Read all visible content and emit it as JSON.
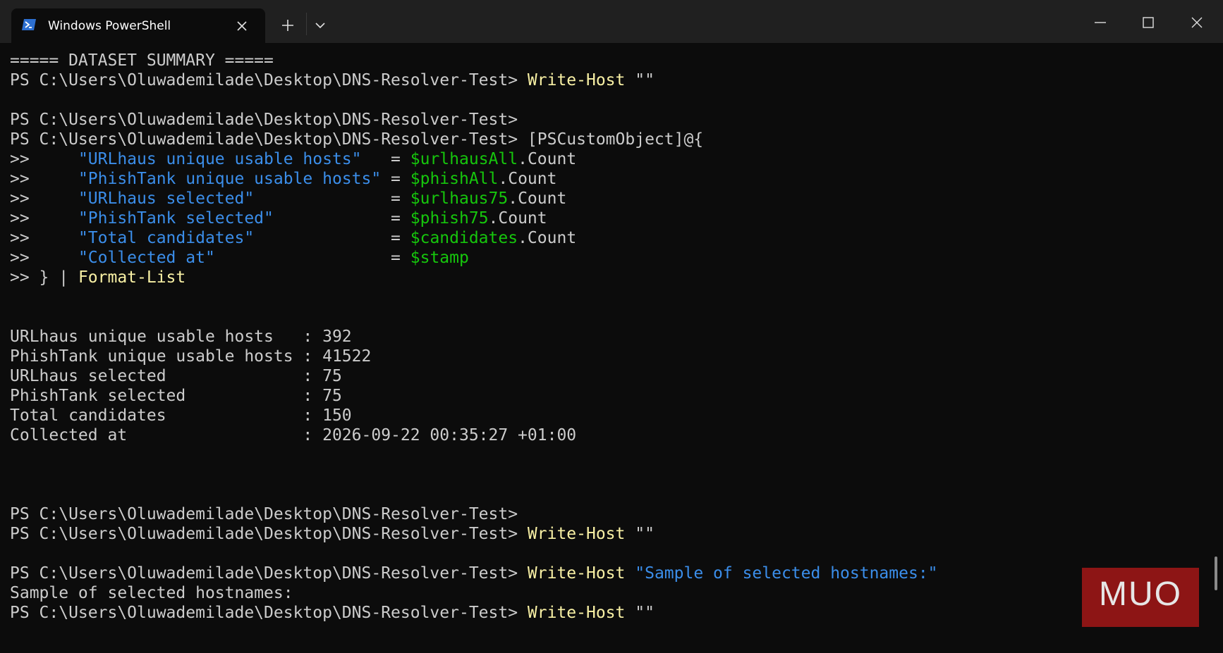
{
  "window": {
    "tab_title": "Windows PowerShell",
    "new_tab_icon": "plus-icon",
    "dropdown_icon": "chevron-down-icon",
    "controls": [
      "minimize-icon",
      "maximize-icon",
      "close-icon"
    ]
  },
  "colors": {
    "background": "#0c0c0c",
    "titlebar": "#202020",
    "default_text": "#cccccc",
    "command": "#f9f1a5",
    "string": "#3b8eea",
    "variable": "#16c60c",
    "watermark": "#a51818"
  },
  "terminal": {
    "lines": [
      [
        {
          "t": "===== DATASET SUMMARY =====",
          "c": "gray"
        }
      ],
      [
        {
          "t": "PS C:\\Users\\Oluwademilade\\Desktop\\DNS-Resolver-Test> ",
          "c": "gray"
        },
        {
          "t": "Write-Host",
          "c": "yellow"
        },
        {
          "t": " \"\"",
          "c": "gray"
        }
      ],
      [],
      [
        {
          "t": "PS C:\\Users\\Oluwademilade\\Desktop\\DNS-Resolver-Test>",
          "c": "gray"
        }
      ],
      [
        {
          "t": "PS C:\\Users\\Oluwademilade\\Desktop\\DNS-Resolver-Test> ",
          "c": "gray"
        },
        {
          "t": "[PSCustomObject]@{",
          "c": "gray"
        }
      ],
      [
        {
          "t": ">>     ",
          "c": "gray"
        },
        {
          "t": "\"URLhaus unique usable hosts\"",
          "c": "blue"
        },
        {
          "t": "   = ",
          "c": "gray"
        },
        {
          "t": "$urlhausAll",
          "c": "green"
        },
        {
          "t": ".Count",
          "c": "gray"
        }
      ],
      [
        {
          "t": ">>     ",
          "c": "gray"
        },
        {
          "t": "\"PhishTank unique usable hosts\"",
          "c": "blue"
        },
        {
          "t": " = ",
          "c": "gray"
        },
        {
          "t": "$phishAll",
          "c": "green"
        },
        {
          "t": ".Count",
          "c": "gray"
        }
      ],
      [
        {
          "t": ">>     ",
          "c": "gray"
        },
        {
          "t": "\"URLhaus selected\"",
          "c": "blue"
        },
        {
          "t": "              = ",
          "c": "gray"
        },
        {
          "t": "$urlhaus75",
          "c": "green"
        },
        {
          "t": ".Count",
          "c": "gray"
        }
      ],
      [
        {
          "t": ">>     ",
          "c": "gray"
        },
        {
          "t": "\"PhishTank selected\"",
          "c": "blue"
        },
        {
          "t": "            = ",
          "c": "gray"
        },
        {
          "t": "$phish75",
          "c": "green"
        },
        {
          "t": ".Count",
          "c": "gray"
        }
      ],
      [
        {
          "t": ">>     ",
          "c": "gray"
        },
        {
          "t": "\"Total candidates\"",
          "c": "blue"
        },
        {
          "t": "              = ",
          "c": "gray"
        },
        {
          "t": "$candidates",
          "c": "green"
        },
        {
          "t": ".Count",
          "c": "gray"
        }
      ],
      [
        {
          "t": ">>     ",
          "c": "gray"
        },
        {
          "t": "\"Collected at\"",
          "c": "blue"
        },
        {
          "t": "                  = ",
          "c": "gray"
        },
        {
          "t": "$stamp",
          "c": "green"
        }
      ],
      [
        {
          "t": ">> } | ",
          "c": "gray"
        },
        {
          "t": "Format-List",
          "c": "yellow"
        }
      ],
      [],
      [],
      [
        {
          "t": "URLhaus unique usable hosts   : 392",
          "c": "gray"
        }
      ],
      [
        {
          "t": "PhishTank unique usable hosts : 41522",
          "c": "gray"
        }
      ],
      [
        {
          "t": "URLhaus selected              : 75",
          "c": "gray"
        }
      ],
      [
        {
          "t": "PhishTank selected            : 75",
          "c": "gray"
        }
      ],
      [
        {
          "t": "Total candidates              : 150",
          "c": "gray"
        }
      ],
      [
        {
          "t": "Collected at                  : 2026-09-22 00:35:27 +01:00",
          "c": "gray"
        }
      ],
      [],
      [],
      [],
      [
        {
          "t": "PS C:\\Users\\Oluwademilade\\Desktop\\DNS-Resolver-Test>",
          "c": "gray"
        }
      ],
      [
        {
          "t": "PS C:\\Users\\Oluwademilade\\Desktop\\DNS-Resolver-Test> ",
          "c": "gray"
        },
        {
          "t": "Write-Host",
          "c": "yellow"
        },
        {
          "t": " \"\"",
          "c": "gray"
        }
      ],
      [],
      [
        {
          "t": "PS C:\\Users\\Oluwademilade\\Desktop\\DNS-Resolver-Test> ",
          "c": "gray"
        },
        {
          "t": "Write-Host",
          "c": "yellow"
        },
        {
          "t": " ",
          "c": "gray"
        },
        {
          "t": "\"Sample of selected hostnames:\"",
          "c": "blue"
        }
      ],
      [
        {
          "t": "Sample of selected hostnames:",
          "c": "gray"
        }
      ],
      [
        {
          "t": "PS C:\\Users\\Oluwademilade\\Desktop\\DNS-Resolver-Test> ",
          "c": "gray"
        },
        {
          "t": "Write-Host",
          "c": "yellow"
        },
        {
          "t": " \"\"",
          "c": "gray"
        }
      ]
    ]
  },
  "watermark": {
    "text": "MUO"
  }
}
